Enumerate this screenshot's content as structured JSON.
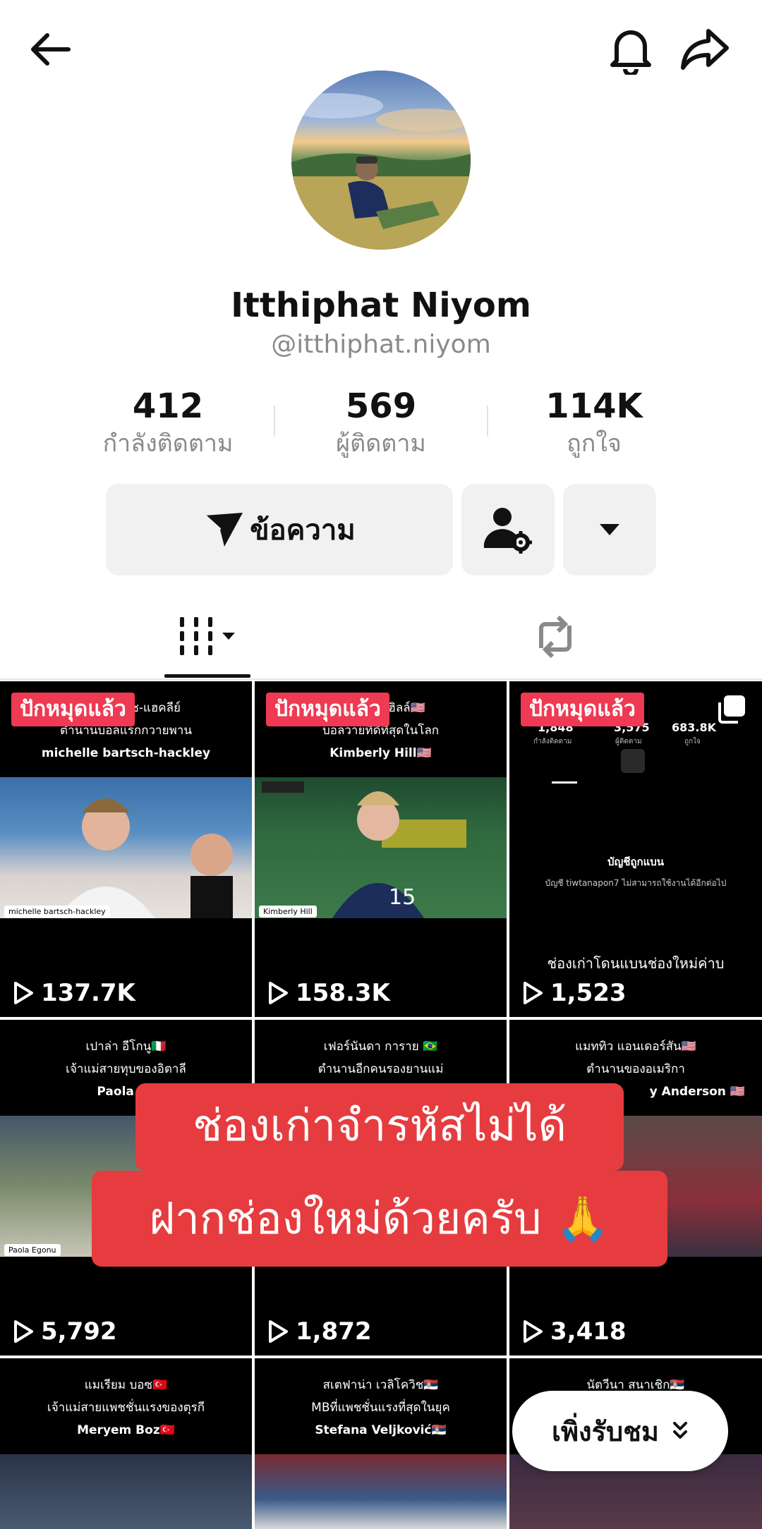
{
  "header": {
    "back_icon": "arrow-left-icon",
    "bell_icon": "bell-icon",
    "share_icon": "share-icon"
  },
  "profile": {
    "display_name": "Itthiphat Niyom",
    "handle": "@itthiphat.niyom",
    "stats": [
      {
        "value": "412",
        "label": "กำลังติดตาม"
      },
      {
        "value": "569",
        "label": "ผู้ติดตาม"
      },
      {
        "value": "114K",
        "label": "ถูกใจ"
      }
    ]
  },
  "actions": {
    "message_label": "ข้อความ"
  },
  "colors": {
    "accent": "#ee3a53",
    "banner": "#e63c3f"
  },
  "videos": [
    {
      "tag": "ปักหมุดแล้ว",
      "captions": [
        "มิเชลล์ บาร์ช-แฮคลีย์",
        "ตำนานบอลแรกกวายพาน",
        "michelle bartsch-hackley"
      ],
      "name_tag": "michelle bartsch-hackley",
      "views": "137.7K"
    },
    {
      "tag": "ปักหมุดแล้ว",
      "captions": [
        "คิมเบอร์ลี ฮิลล์🇺🇸",
        "บอลวายที่ดีที่สุดในโลก",
        "Kimberly Hill🇺🇸"
      ],
      "name_tag": "Kimberly Hill",
      "views": "158.3K"
    },
    {
      "tag": "ปักหมุดแล้ว",
      "captions": [
        "1,848",
        "3,575",
        "683.8K",
        "กำลังติดตาม",
        "ผู้ติดตาม",
        "ถูกใจ",
        "บัญชีถูกแบน",
        "บัญชี tiwtanapon7 ไม่สามารถใช้งานได้อีกต่อไป",
        "ช่องเก่าโดนแบนช่องใหม่ค่าบ"
      ],
      "views": "1,523"
    },
    {
      "captions": [
        "เปาล่า อีโกนู🇮🇹",
        "เจ้าแม่สายทุบของอิตาลี",
        "Paola Eg"
      ],
      "name_tag": "Paola Egonu",
      "views": "5,792"
    },
    {
      "captions": [
        "เฟอร์นันดา การาย 🇧🇷",
        "ตำนานอีกคนรองยานแม่"
      ],
      "views": "1,872"
    },
    {
      "captions": [
        "แมททิว แอนเดอร์สัน🇺🇸",
        "ตำนานของอเมริกา",
        "y Anderson 🇺🇸"
      ],
      "views": "3,418"
    },
    {
      "captions": [
        "แมเรียม บอซ🇹🇷",
        "เจ้าแม่สายแพชชั่นแรงของตุรกี",
        "Meryem Boz🇹🇷"
      ]
    },
    {
      "captions": [
        "สเตฟาน่า เวลิโควิช🇷🇸",
        "MBที่แพชชั่นแรงที่สุดในยุค",
        "Stefana Veljković🇷🇸"
      ]
    },
    {
      "captions": [
        "นัตวีนา สนาเชิก🇷🇸"
      ]
    }
  ],
  "banner": {
    "line1": "ช่องเก่าจำรหัสไม่ได้",
    "line2": "ฝากช่องใหม่ด้วยครับ 🙏"
  },
  "recent": {
    "label": "เพิ่งรับชม"
  }
}
